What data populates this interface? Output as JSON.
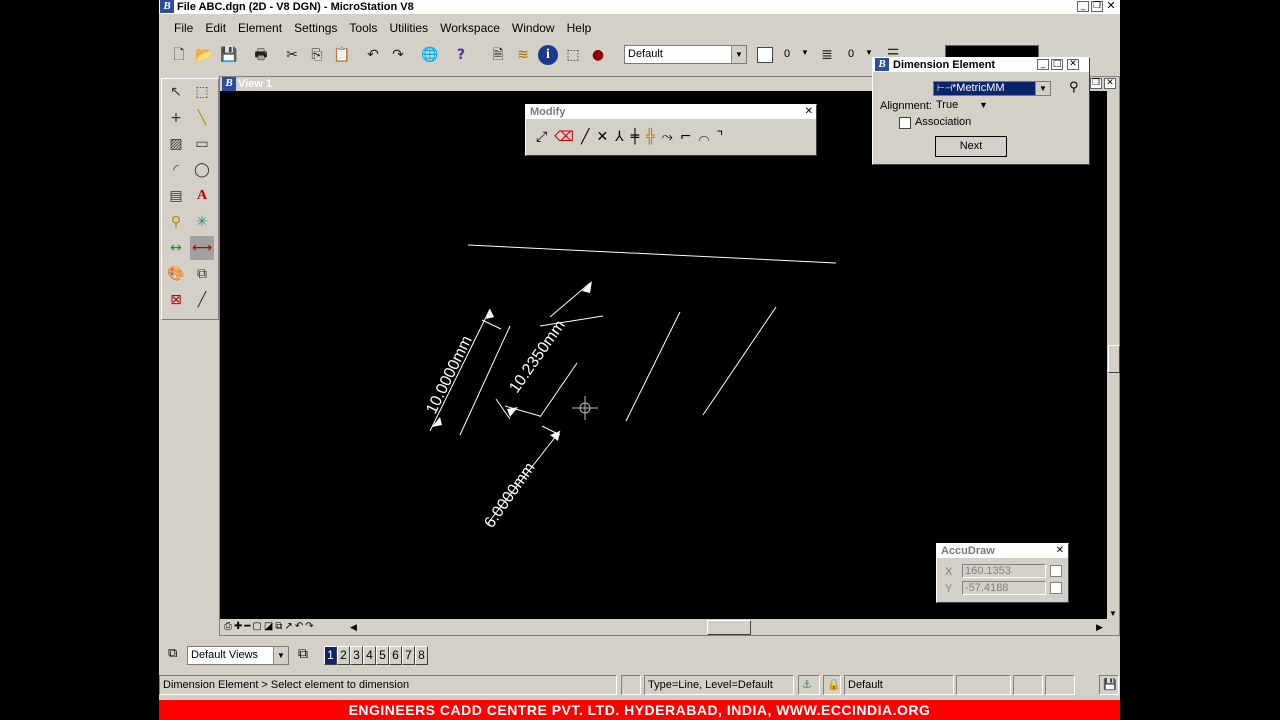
{
  "window": {
    "title": "File ABC.dgn (2D - V8 DGN) - MicroStation V8"
  },
  "menu": [
    "File",
    "Edit",
    "Element",
    "Settings",
    "Tools",
    "Utilities",
    "Workspace",
    "Window",
    "Help"
  ],
  "toolbar": {
    "active_level": "Default",
    "color_value": "0",
    "style_value": "0"
  },
  "view": {
    "title": "View 1"
  },
  "modify_panel": {
    "title": "Modify"
  },
  "dimension_panel": {
    "title": "Dimension Element",
    "style_value": "*MetricMM",
    "alignment_label": "Alignment:",
    "alignment_value": "True",
    "association_label": "Association",
    "next_label": "Next"
  },
  "accudraw": {
    "title": "AccuDraw",
    "x_label": "X",
    "x_value": "160.1353",
    "y_label": "Y",
    "y_value": "-57.4188"
  },
  "dimension_labels": [
    "10.0000mm",
    "10.2350mm",
    "6.0000mm"
  ],
  "view_group": {
    "value": "Default Views",
    "views": [
      "1",
      "2",
      "3",
      "4",
      "5",
      "6",
      "7",
      "8"
    ]
  },
  "status": {
    "prompt": "Dimension Element > Select element to dimension",
    "element_info": "Type=Line, Level=Default",
    "active_level": "Default"
  },
  "banner": "ENGINEERS CADD CENTRE PVT. LTD. HYDERABAD, INDIA, WWW.ECCINDIA.ORG"
}
